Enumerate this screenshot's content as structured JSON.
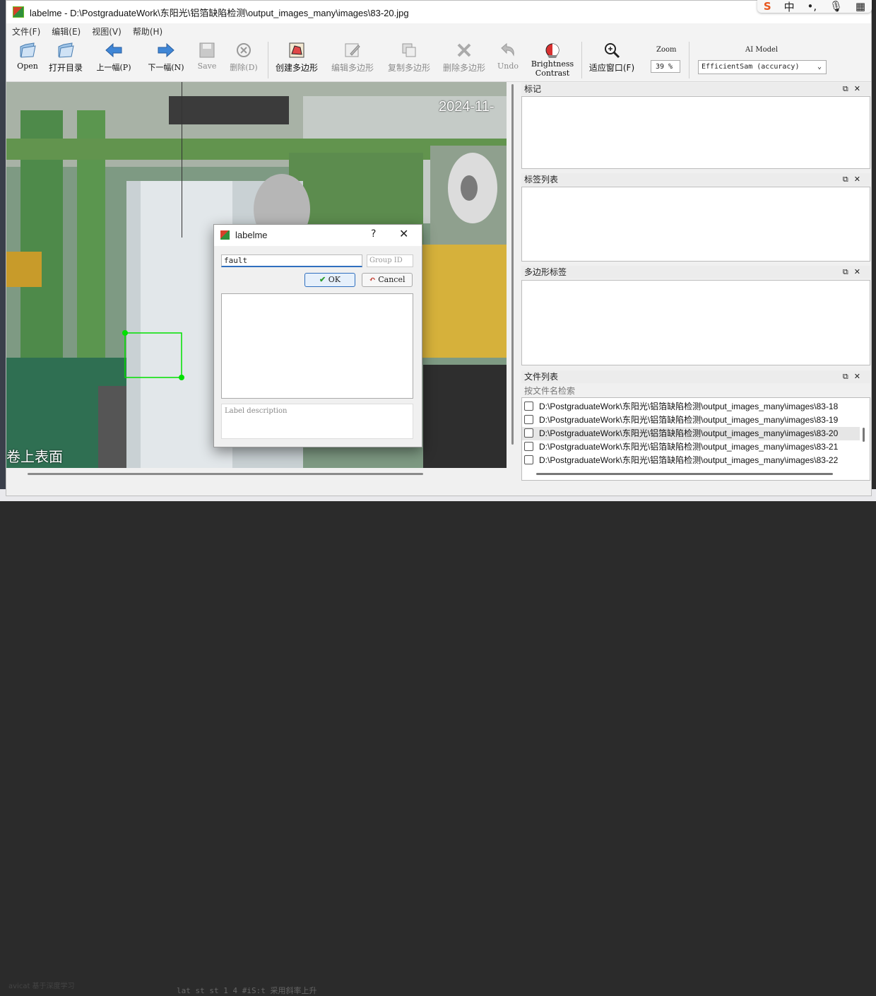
{
  "window": {
    "title": "labelme - D:\\PostgraduateWork\\东阳光\\铝箔缺陷检测\\output_images_many\\images\\83-20.jpg"
  },
  "ime": {
    "logo": "S",
    "lang": "中"
  },
  "menu": [
    "文件(F)",
    "编辑(E)",
    "视图(V)",
    "帮助(H)"
  ],
  "toolbar": {
    "open": "Open",
    "open_dir": "打开目录",
    "prev": "上一幅(P)",
    "next": "下一幅(N)",
    "save": "Save",
    "delete": "删除(D)",
    "create_poly": "创建多边形",
    "edit_poly": "编辑多边形",
    "copy_poly": "复制多边形",
    "delete_poly": "删除多边形",
    "undo": "Undo",
    "brightness_1": "Brightness",
    "brightness_2": "Contrast",
    "fit_window": "适应窗口(F)",
    "zoom_label": "Zoom",
    "zoom_value": "39 %",
    "ai_label": "AI Model",
    "ai_value": "EfficientSam (accuracy)"
  },
  "canvas": {
    "timestamp": "2024-11-",
    "overlay_text": "卷上表面"
  },
  "docks": {
    "flags": "标记",
    "label_list": "标签列表",
    "polygon_labels": "多边形标签",
    "file_list": "文件列表",
    "file_search_placeholder": "按文件名检索"
  },
  "files": [
    {
      "path": "D:\\PostgraduateWork\\东阳光\\铝箔缺陷检测\\output_images_many\\images\\83-18",
      "selected": false
    },
    {
      "path": "D:\\PostgraduateWork\\东阳光\\铝箔缺陷检测\\output_images_many\\images\\83-19",
      "selected": false
    },
    {
      "path": "D:\\PostgraduateWork\\东阳光\\铝箔缺陷检测\\output_images_many\\images\\83-20",
      "selected": true
    },
    {
      "path": "D:\\PostgraduateWork\\东阳光\\铝箔缺陷检测\\output_images_many\\images\\83-21",
      "selected": false
    },
    {
      "path": "D:\\PostgraduateWork\\东阳光\\铝箔缺陷检测\\output_images_many\\images\\83-22",
      "selected": false
    }
  ],
  "dialog": {
    "title": "labelme",
    "help": "?",
    "label_value": "fault",
    "group_placeholder": "Group ID",
    "ok": "OK",
    "cancel": "Cancel",
    "desc_placeholder": "Label description"
  },
  "taskbar": {
    "left_text": "avicat   基于深度学习",
    "code_text": "lat  st  st  1  4  #iS:t 采用斜率上升"
  },
  "colors": {
    "selection_green": "#00e000",
    "accent_blue": "#2f6fbf"
  }
}
